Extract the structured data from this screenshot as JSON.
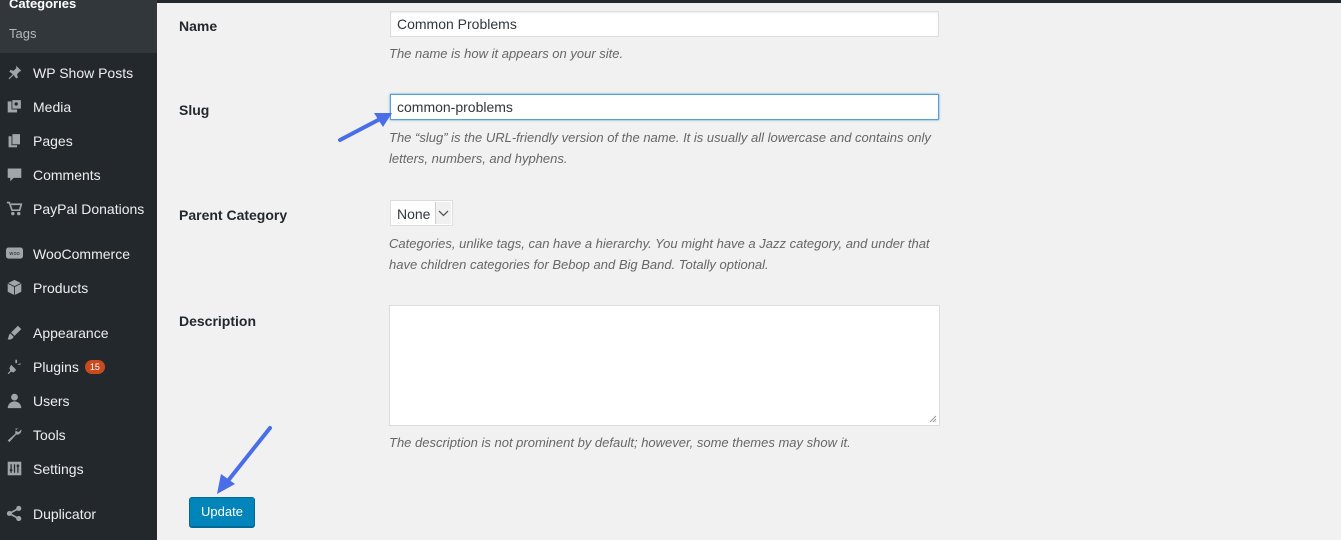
{
  "sidebar": {
    "submenu": {
      "current": "Categories",
      "tags": "Tags"
    },
    "items": [
      {
        "label": "WP Show Posts",
        "icon": "pin-icon"
      },
      {
        "label": "Media",
        "icon": "media-icon"
      },
      {
        "label": "Pages",
        "icon": "pages-icon"
      },
      {
        "label": "Comments",
        "icon": "comments-icon"
      },
      {
        "label": "PayPal Donations",
        "icon": "cart-icon"
      },
      {
        "label": "WooCommerce",
        "icon": "woo-icon"
      },
      {
        "label": "Products",
        "icon": "box-icon"
      },
      {
        "label": "Appearance",
        "icon": "brush-icon"
      },
      {
        "label": "Plugins",
        "icon": "plug-icon",
        "badge": "15"
      },
      {
        "label": "Users",
        "icon": "user-icon"
      },
      {
        "label": "Tools",
        "icon": "wrench-icon"
      },
      {
        "label": "Settings",
        "icon": "settings-icon"
      },
      {
        "label": "Duplicator",
        "icon": "share-icon"
      }
    ]
  },
  "form": {
    "name": {
      "label": "Name",
      "value": "Common Problems",
      "description": "The name is how it appears on your site."
    },
    "slug": {
      "label": "Slug",
      "value": "common-problems",
      "description": "The “slug” is the URL-friendly version of the name. It is usually all lowercase and contains only letters, numbers, and hyphens."
    },
    "parent": {
      "label": "Parent Category",
      "value": "None",
      "description": "Categories, unlike tags, can have a hierarchy. You might have a Jazz category, and under that have children categories for Bebop and Big Band. Totally optional."
    },
    "description": {
      "label": "Description",
      "value": "",
      "description": "The description is not prominent by default; however, some themes may show it."
    },
    "update_label": "Update"
  },
  "colors": {
    "sidebar_bg": "#23282d",
    "accent_button": "#0085ba",
    "badge": "#ca4a1f",
    "annotation_arrow": "#4a6ee8"
  }
}
